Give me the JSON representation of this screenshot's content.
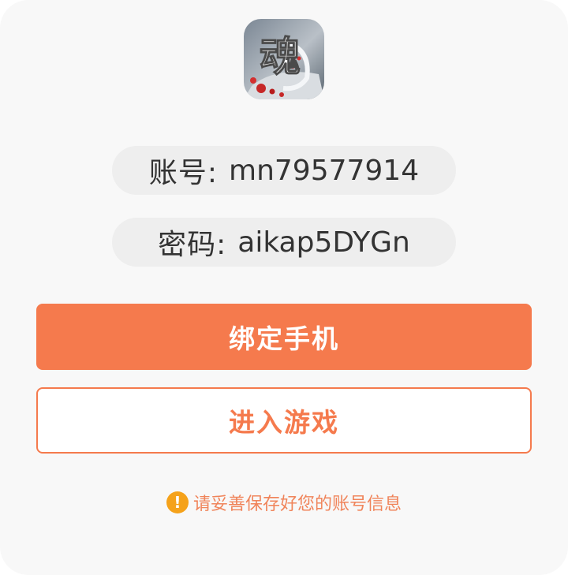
{
  "colors": {
    "primary": "#f57a4d",
    "notice_text": "#f0845a",
    "warning": "#f5a21a"
  },
  "app_icon": {
    "name": "game-logo-icon",
    "glyph": "魂"
  },
  "account": {
    "label": "账号:",
    "value": "mn79577914"
  },
  "password": {
    "label": "密码:",
    "value": "aikap5DYGn"
  },
  "buttons": {
    "bind_phone": "绑定手机",
    "enter_game": "进入游戏"
  },
  "notice": {
    "icon": "exclamation-circle-icon",
    "text": "请妥善保存好您的账号信息"
  }
}
